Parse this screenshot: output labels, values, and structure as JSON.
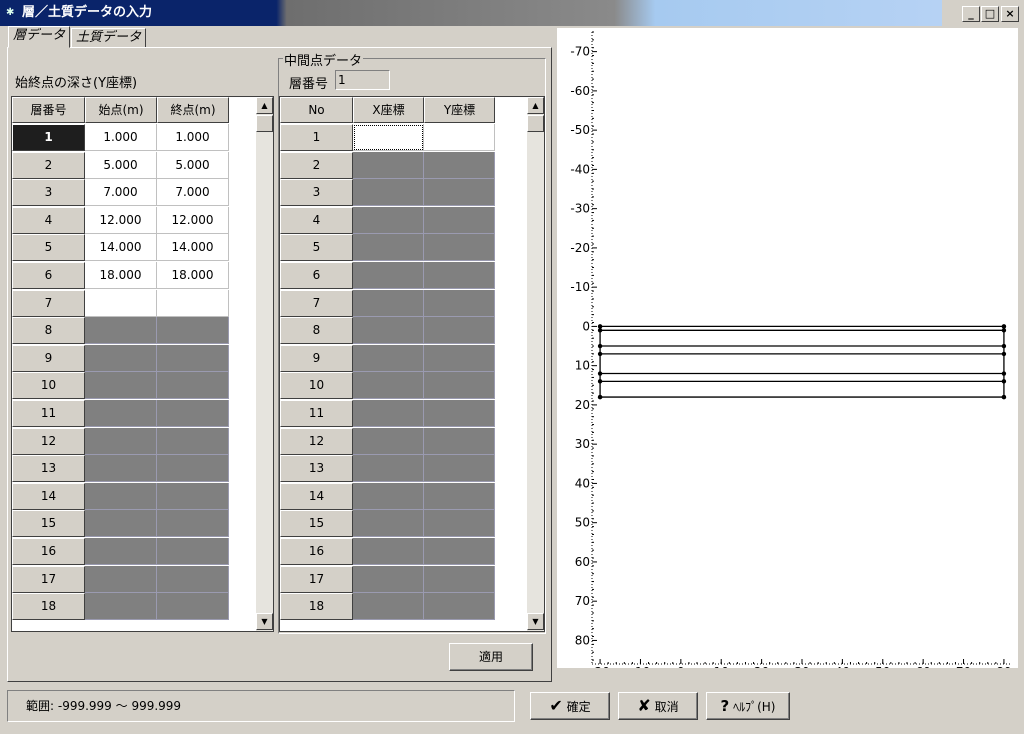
{
  "window": {
    "title": "層／土質データの入力"
  },
  "titlebar_buttons": {
    "minimize": "_",
    "maximize": "□",
    "close": "×"
  },
  "tabs": [
    {
      "label": "層データ"
    },
    {
      "label": "土質データ"
    }
  ],
  "layer_section": {
    "label": "始終点の深さ(Y座標)",
    "headers": {
      "no": "層番号",
      "start": "始点(m)",
      "end": "終点(m)"
    },
    "rows": [
      {
        "no": "1",
        "start": "1.000",
        "end": "1.000"
      },
      {
        "no": "2",
        "start": "5.000",
        "end": "5.000"
      },
      {
        "no": "3",
        "start": "7.000",
        "end": "7.000"
      },
      {
        "no": "4",
        "start": "12.000",
        "end": "12.000"
      },
      {
        "no": "5",
        "start": "14.000",
        "end": "14.000"
      },
      {
        "no": "6",
        "start": "18.000",
        "end": "18.000"
      },
      {
        "no": "7",
        "start": "",
        "end": ""
      },
      {
        "no": "8",
        "start": "",
        "end": ""
      },
      {
        "no": "9",
        "start": "",
        "end": ""
      },
      {
        "no": "10",
        "start": "",
        "end": ""
      },
      {
        "no": "11",
        "start": "",
        "end": ""
      },
      {
        "no": "12",
        "start": "",
        "end": ""
      },
      {
        "no": "13",
        "start": "",
        "end": ""
      },
      {
        "no": "14",
        "start": "",
        "end": ""
      },
      {
        "no": "15",
        "start": "",
        "end": ""
      },
      {
        "no": "16",
        "start": "",
        "end": ""
      },
      {
        "no": "17",
        "start": "",
        "end": ""
      },
      {
        "no": "18",
        "start": "",
        "end": ""
      }
    ],
    "selected_row": "1",
    "editable_rows": 7
  },
  "intermediate": {
    "title": "中間点データ",
    "layer_no_label": "層番号",
    "layer_no_value": "1",
    "headers": {
      "no": "No",
      "x": "X座標",
      "y": "Y座標"
    },
    "rows": [
      "1",
      "2",
      "3",
      "4",
      "5",
      "6",
      "7",
      "8",
      "9",
      "10",
      "11",
      "12",
      "13",
      "14",
      "15",
      "16",
      "17",
      "18"
    ],
    "editable_rows": 1
  },
  "apply_button": {
    "label": "適用"
  },
  "status": {
    "range_text": "範囲: -999.999 ～ 999.999"
  },
  "buttons": {
    "ok": {
      "label": "確定",
      "icon": "check-icon"
    },
    "cancel": {
      "label": "取消",
      "icon": "x-icon"
    },
    "help": {
      "label": "ﾍﾙﾌﾟ(H)",
      "icon": "question-icon"
    }
  },
  "chart_data": {
    "type": "line",
    "title": "",
    "xlabel": "",
    "ylabel": "",
    "xlim": [
      -22,
      82
    ],
    "ylim": [
      -75,
      86
    ],
    "y_inverted": true,
    "x_ticks": [
      -20,
      -10,
      0,
      10,
      20,
      30,
      40,
      50,
      60,
      70,
      80
    ],
    "y_ticks": [
      -70,
      -60,
      -50,
      -40,
      -30,
      -20,
      -10,
      0,
      10,
      20,
      30,
      40,
      50,
      60,
      70,
      80
    ],
    "series": [
      {
        "x": [
          -20,
          80
        ],
        "y": [
          0,
          0
        ]
      },
      {
        "x": [
          -20,
          80
        ],
        "y": [
          1,
          1
        ]
      },
      {
        "x": [
          -20,
          80
        ],
        "y": [
          5,
          5
        ]
      },
      {
        "x": [
          -20,
          80
        ],
        "y": [
          7,
          7
        ]
      },
      {
        "x": [
          -20,
          80
        ],
        "y": [
          12,
          12
        ]
      },
      {
        "x": [
          -20,
          80
        ],
        "y": [
          14,
          14
        ]
      },
      {
        "x": [
          -20,
          80
        ],
        "y": [
          18,
          18
        ]
      },
      {
        "x": [
          -20,
          -20
        ],
        "y": [
          0,
          18
        ]
      },
      {
        "x": [
          80,
          80
        ],
        "y": [
          0,
          18
        ]
      }
    ]
  }
}
